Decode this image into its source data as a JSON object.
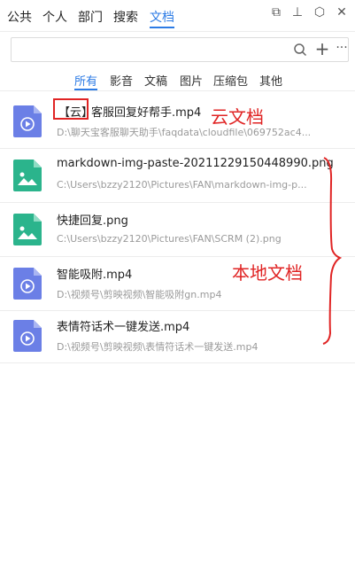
{
  "nav": {
    "tabs": [
      "公共",
      "个人",
      "部门",
      "搜索",
      "文档"
    ],
    "active": "文档"
  },
  "window_controls": {
    "restore": "⧉",
    "pin": "⊥",
    "settings": "⬡",
    "close": "✕"
  },
  "search": {
    "value": "",
    "placeholder": "",
    "plus": "+",
    "more": "···"
  },
  "filters": {
    "tabs": [
      "所有",
      "影音",
      "文稿",
      "图片",
      "压缩包",
      "其他"
    ],
    "active": "所有"
  },
  "files": [
    {
      "badge": "【云】",
      "name": "客服回复好帮手.mp4",
      "path": "D:\\聊天宝客服聊天助手\\faqdata\\cloudfile\\069752ac4...",
      "type": "video"
    },
    {
      "name": "markdown-img-paste-20211229150448990.png",
      "path": "C:\\Users\\bzzy2120\\Pictures\\FAN\\markdown-img-p...",
      "type": "image"
    },
    {
      "name": "快捷回复.png",
      "path": "C:\\Users\\bzzy2120\\Pictures\\FAN\\SCRM (2).png",
      "type": "image"
    },
    {
      "name": "智能吸附.mp4",
      "path": "D:\\视频号\\剪映视频\\智能吸附gn.mp4",
      "type": "video"
    },
    {
      "name": "表情符话术一键发送.mp4",
      "path": "D:\\视频号\\剪映视频\\表情符话术一键发送.mp4",
      "type": "video"
    }
  ],
  "annotations": {
    "cloud": "云文档",
    "local": "本地文档",
    "color": "#e02424"
  },
  "colors": {
    "accent": "#2c7be5",
    "video_icon": "#6b7fe6",
    "image_icon": "#2bb48c"
  }
}
